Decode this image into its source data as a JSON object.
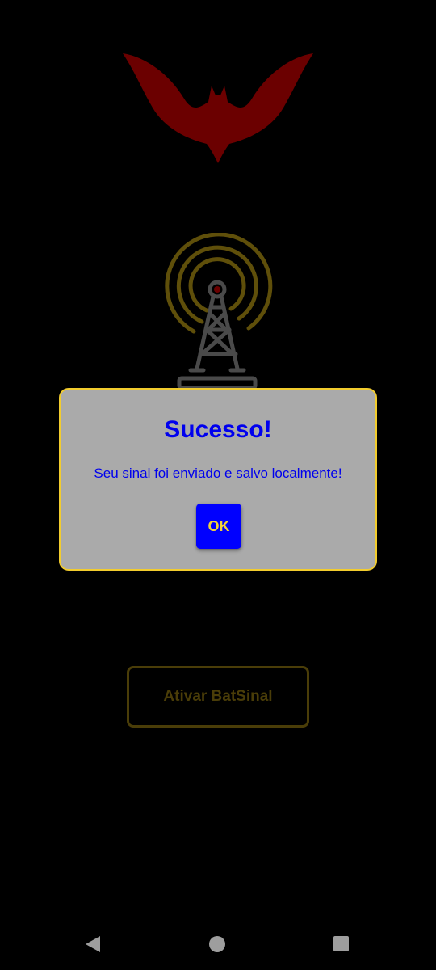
{
  "screen": {
    "logo_icon": "bat-logo-icon",
    "signal_icon": "radio-tower-icon",
    "activate_button_label": "Ativar BatSinal"
  },
  "dialog": {
    "title": "Sucesso!",
    "message": "Seu sinal foi enviado e salvo localmente!",
    "ok_label": "OK"
  },
  "nav": {
    "back_icon": "back-triangle-icon",
    "home_icon": "home-circle-icon",
    "recents_icon": "recents-square-icon"
  },
  "colors": {
    "background": "#000000",
    "bat_logo": "#6b0000",
    "accent_yellow": "#f2cc2e",
    "dialog_background": "#aaaaaa",
    "dialog_text": "#0000ee",
    "ok_button": "#0000ff"
  }
}
